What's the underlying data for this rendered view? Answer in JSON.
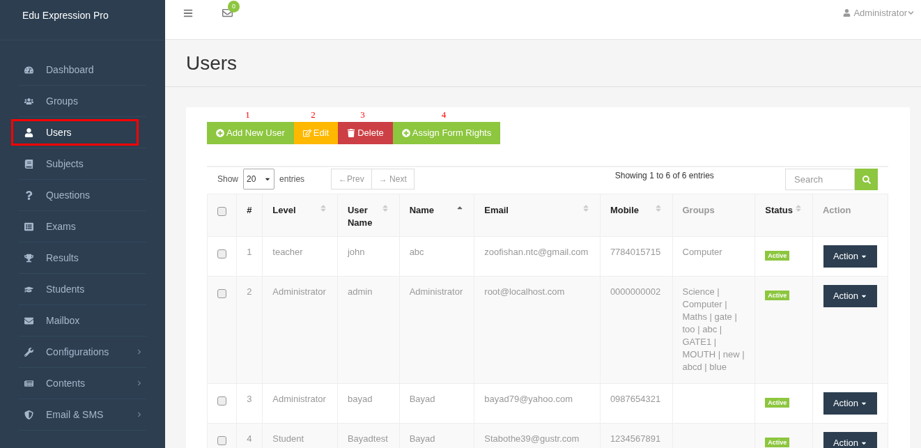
{
  "brand": "Edu Expression Pro",
  "topbar": {
    "mail_count": "0",
    "user": "Administrator"
  },
  "sidebar": {
    "items": [
      {
        "label": "Dashboard",
        "selected": false,
        "expandable": false
      },
      {
        "label": "Groups",
        "selected": false,
        "expandable": false
      },
      {
        "label": "Users",
        "selected": true,
        "expandable": false
      },
      {
        "label": "Subjects",
        "selected": false,
        "expandable": false
      },
      {
        "label": "Questions",
        "selected": false,
        "expandable": false
      },
      {
        "label": "Exams",
        "selected": false,
        "expandable": false
      },
      {
        "label": "Results",
        "selected": false,
        "expandable": false
      },
      {
        "label": "Students",
        "selected": false,
        "expandable": false
      },
      {
        "label": "Mailbox",
        "selected": false,
        "expandable": false
      },
      {
        "label": "Configurations",
        "selected": false,
        "expandable": true
      },
      {
        "label": "Contents",
        "selected": false,
        "expandable": true
      },
      {
        "label": "Email & SMS",
        "selected": false,
        "expandable": true
      }
    ]
  },
  "page_title": "Users",
  "toolbar": [
    {
      "marker": "1",
      "label": "Add New User",
      "kind": "add",
      "color": "#8dc63f"
    },
    {
      "marker": "2",
      "label": "Edit",
      "kind": "edit",
      "color": "#ffb800"
    },
    {
      "marker": "3",
      "label": "Delete",
      "kind": "delete",
      "color": "#cc3f44"
    },
    {
      "marker": "4",
      "label": "Assign Form Rights",
      "kind": "add",
      "color": "#8dc63f"
    }
  ],
  "table_controls": {
    "show_label": "Show",
    "page_size": "20",
    "entries_label": "entries",
    "prev": "←Prev",
    "next": "→ Next",
    "info": "Showing 1 to 6 of 6 entries",
    "search_placeholder": "Search"
  },
  "table": {
    "all_checked": false,
    "columns": [
      {
        "label": "#",
        "sortable": false,
        "disabled": false
      },
      {
        "label": "Level",
        "sortable": true,
        "sorted": false,
        "disabled": false
      },
      {
        "label": "User Name",
        "sortable": true,
        "sorted": false,
        "disabled": false
      },
      {
        "label": "Name",
        "sortable": true,
        "sorted": true,
        "disabled": false
      },
      {
        "label": "Email",
        "sortable": true,
        "sorted": false,
        "disabled": false
      },
      {
        "label": "Mobile",
        "sortable": true,
        "sorted": false,
        "disabled": false
      },
      {
        "label": "Groups",
        "sortable": false,
        "disabled": true
      },
      {
        "label": "Status",
        "sortable": true,
        "sorted": false,
        "disabled": false
      },
      {
        "label": "Action",
        "sortable": false,
        "disabled": true
      }
    ],
    "rows": [
      {
        "checked": false,
        "number": "1",
        "level": "teacher",
        "user_name": "john",
        "name": "abc",
        "email": "zoofishan.ntc@gmail.com",
        "mobile": "7784015715",
        "groups": "Computer",
        "status": "Active",
        "action": "Action"
      },
      {
        "checked": false,
        "number": "2",
        "level": "Administrator",
        "user_name": "admin",
        "name": "Administrator",
        "email": "root@localhost.com",
        "mobile": "0000000002",
        "groups": "Science | Computer | Maths | gate | too | abc | GATE1 | MOUTH | new | abcd | blue",
        "status": "Active",
        "action": "Action"
      },
      {
        "checked": false,
        "number": "3",
        "level": "Administrator",
        "user_name": "bayad",
        "name": "Bayad",
        "email": "bayad79@yahoo.com",
        "mobile": "0987654321",
        "status": "Active",
        "action": "Action"
      },
      {
        "checked": false,
        "number": "4",
        "level": "Student",
        "user_name": "Bayadtest",
        "name": "Bayad",
        "email": "Stabothe39@gustr.com",
        "mobile": "1234567891",
        "status": "Active",
        "action": "Action"
      }
    ]
  }
}
